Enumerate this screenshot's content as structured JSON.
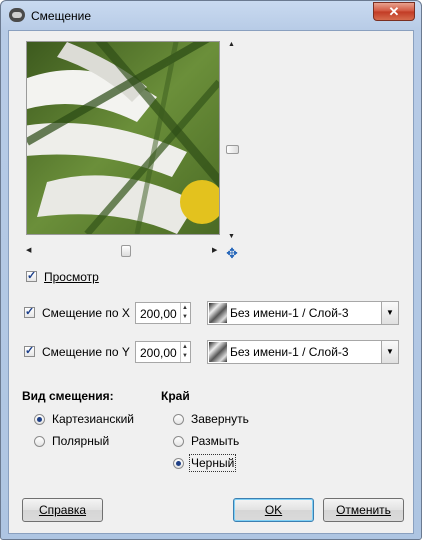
{
  "window": {
    "title": "Смещение",
    "close_glyph": "✕"
  },
  "preview": {
    "checkbox_label": "Просмотр",
    "checked": true,
    "image_desc": "daisy-petals-displaced"
  },
  "displace_x": {
    "checked": true,
    "label": "Смещение по X",
    "mnemonic": "X",
    "value": "200,00",
    "drawable": "Без имени-1 / Слой-3"
  },
  "displace_y": {
    "checked": true,
    "label": "Смещение по Y",
    "mnemonic": "Y",
    "value": "200,00",
    "drawable": "Без имени-1 / Слой-3"
  },
  "mode": {
    "title": "Вид смещения:",
    "options": [
      {
        "label": "Картезианский",
        "selected": true
      },
      {
        "label": "Полярный",
        "selected": false
      }
    ]
  },
  "edge": {
    "title": "Край",
    "options": [
      {
        "label": "Завернуть",
        "selected": false
      },
      {
        "label": "Размыть",
        "selected": false
      },
      {
        "label": "Черный",
        "selected": true
      }
    ]
  },
  "buttons": {
    "help": "Справка",
    "ok": "OK",
    "cancel": "Отменить"
  },
  "icons": {
    "app": "gimp-icon",
    "navigate": "navigate-icon",
    "dropdown": "chevron-down-icon"
  },
  "colors": {
    "title_bar": "#b7cbe6",
    "close_button": "#c13a24",
    "dialog_bg": "#f0f0f0"
  }
}
